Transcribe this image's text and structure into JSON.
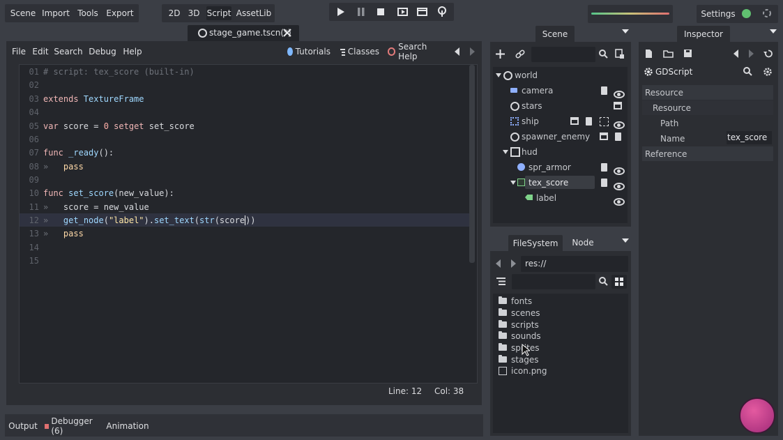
{
  "topbar": {
    "menus": [
      "Scene",
      "Import",
      "Tools",
      "Export"
    ],
    "modes": [
      "2D",
      "3D",
      "Script",
      "AssetLib"
    ],
    "active_mode": "Script",
    "settings_label": "Settings"
  },
  "editor_tab": {
    "label": "stage_game.tscn(*)"
  },
  "script_menu": {
    "items": [
      "File",
      "Edit",
      "Search",
      "Debug",
      "Help"
    ],
    "tutorials": "Tutorials",
    "classes": "Classes",
    "search_help": "Search Help"
  },
  "code": {
    "lines": [
      {
        "n": "01"
      },
      {
        "n": "02"
      },
      {
        "n": "03"
      },
      {
        "n": "04"
      },
      {
        "n": "05"
      },
      {
        "n": "06"
      },
      {
        "n": "07"
      },
      {
        "n": "08"
      },
      {
        "n": "09"
      },
      {
        "n": "10"
      },
      {
        "n": "11"
      },
      {
        "n": "12"
      },
      {
        "n": "13"
      },
      {
        "n": "14"
      },
      {
        "n": "15"
      }
    ],
    "t1": "# script: tex_score (built-in)",
    "t3a": "extends",
    "t3b": " TextureFrame",
    "t5a": "var",
    "t5b": " score = ",
    "t5c": "0",
    "t5d": " setget",
    "t5e": " set_score",
    "t7a": "func",
    "t7b": " _ready",
    "t7c": "():",
    "t8": "pass",
    "t10a": "func",
    "t10b": " set_score",
    "t10c": "(new_value):",
    "t11": "score = new_value",
    "t12a": "get_node",
    "t12b": "(",
    "t12c": "\"label\"",
    "t12d": ").",
    "t12e": "set_text",
    "t12f": "(",
    "t12g": "str",
    "t12h": "(score",
    "t12i": "))",
    "t13": "pass",
    "tab_marker": "»"
  },
  "status": {
    "line": "Line: 12",
    "col": "Col: 38"
  },
  "bottom_tabs": {
    "output": "Output",
    "debugger": "Debugger (6)",
    "animation": "Animation"
  },
  "scene_dock": {
    "tab": "Scene",
    "tree": [
      {
        "name": "world"
      },
      {
        "name": "camera"
      },
      {
        "name": "stars"
      },
      {
        "name": "ship"
      },
      {
        "name": "spawner_enemy"
      },
      {
        "name": "hud"
      },
      {
        "name": "spr_armor"
      },
      {
        "name": "tex_score"
      },
      {
        "name": "label"
      }
    ]
  },
  "fs_dock": {
    "tabs": [
      "FileSystem",
      "Node"
    ],
    "path": "res://",
    "items": [
      "fonts",
      "scenes",
      "scripts",
      "sounds",
      "sprites",
      "stages",
      "icon.png"
    ]
  },
  "inspector": {
    "tab": "Inspector",
    "object": "GDScript",
    "sections": [
      "Resource",
      "Resource",
      "Path",
      "Name",
      "Reference"
    ],
    "name_value": "tex_score"
  },
  "colors": {
    "background": "#3b3e45",
    "panel": "#2c2e33",
    "editor_bg": "#24262b",
    "accent_play": "#e6e7ea",
    "keyword": "#f0b6b6",
    "function": "#9fd8ff",
    "string": "#ffe7a6",
    "settings_check": "#60c070",
    "logo": "#e0408a"
  },
  "icons": [
    "play-icon",
    "pause-icon",
    "stop-icon",
    "play-scene-icon",
    "play-custom-icon",
    "remote-icon",
    "add-node-icon",
    "link-icon",
    "search-icon",
    "eye-icon",
    "script-icon",
    "folder-icon",
    "image-icon",
    "gear-icon"
  ]
}
